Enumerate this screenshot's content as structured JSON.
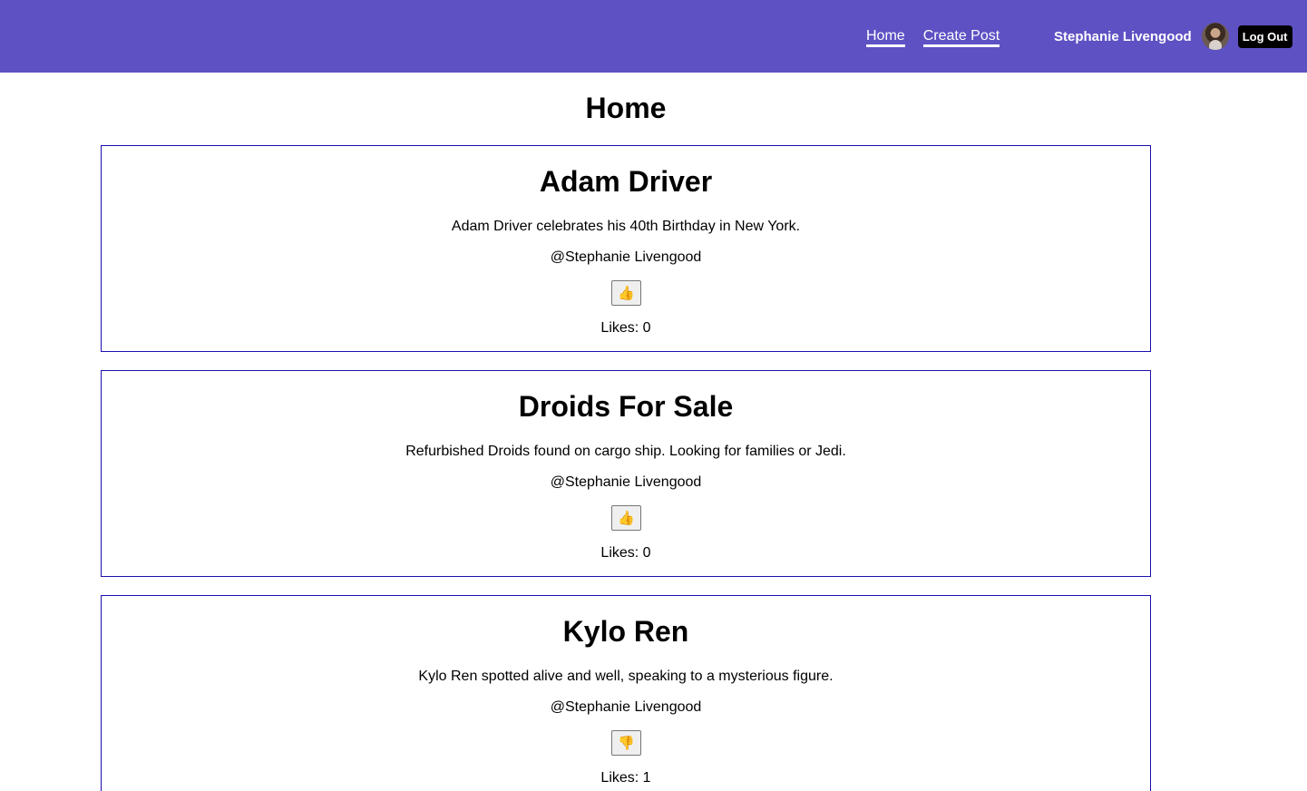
{
  "nav": {
    "links": [
      {
        "label": "Home"
      },
      {
        "label": "Create Post"
      }
    ],
    "user_name": "Stephanie Livengood",
    "logout_label": "Log Out"
  },
  "page": {
    "title": "Home"
  },
  "posts": [
    {
      "title": "Adam Driver",
      "body": "Adam Driver celebrates his 40th Birthday in New York.",
      "author": "@Stephanie Livengood",
      "like_icon": "👍",
      "likes": "Likes: 0"
    },
    {
      "title": "Droids For Sale",
      "body": "Refurbished Droids found on cargo ship. Looking for families or Jedi.",
      "author": "@Stephanie Livengood",
      "like_icon": "👍",
      "likes": "Likes: 0"
    },
    {
      "title": "Kylo Ren",
      "body": "Kylo Ren spotted alive and well, speaking to a mysterious figure.",
      "author": "@Stephanie Livengood",
      "like_icon": "👎",
      "likes": "Likes: 1"
    }
  ],
  "colors": {
    "navbar": "#5e51c4",
    "post_border": "#1a0fb0",
    "logout_bg": "#000000"
  }
}
